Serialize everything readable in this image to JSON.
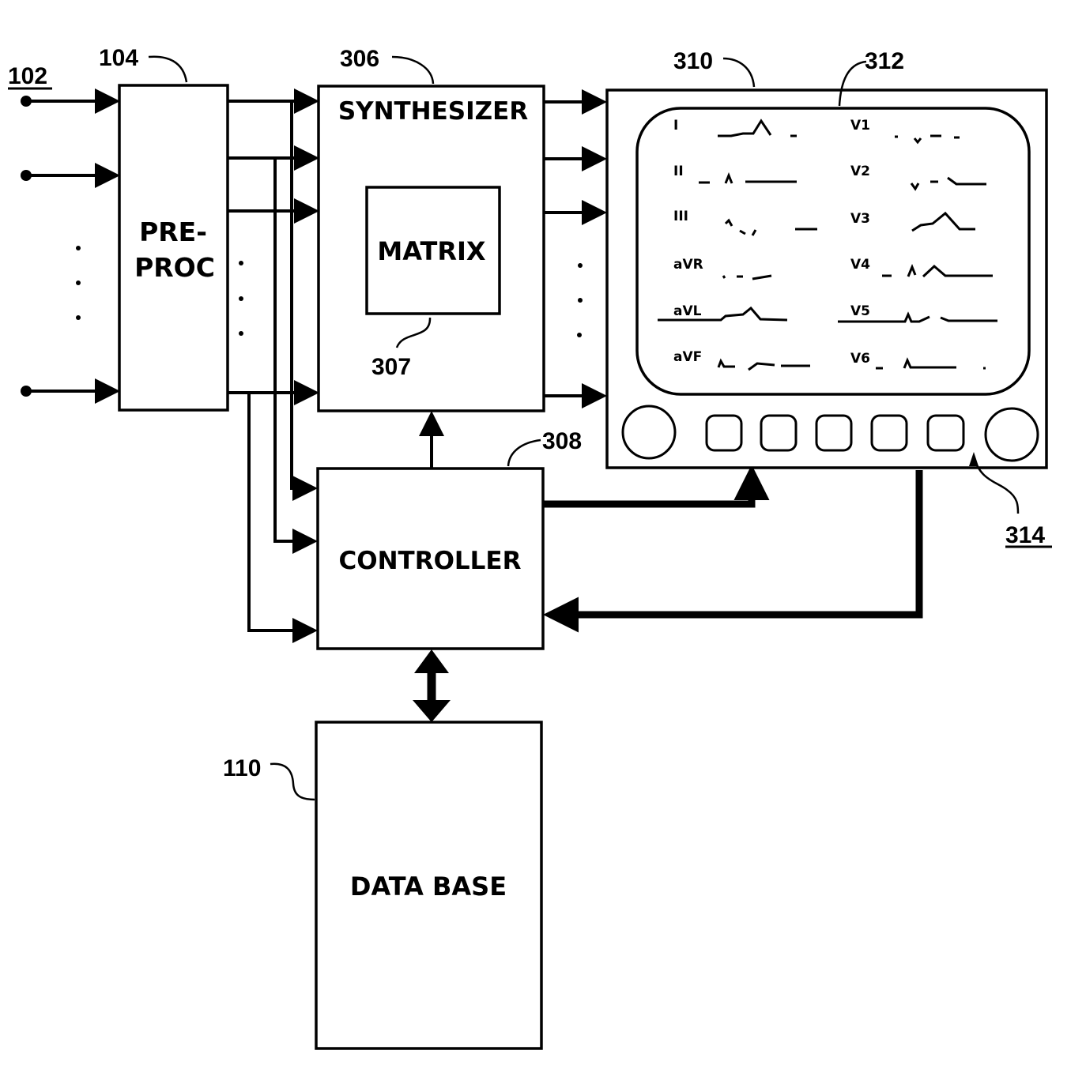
{
  "diagram": {
    "reference_numerals": {
      "inputs": "102",
      "preprocessor": "104",
      "synthesizer": "306",
      "matrix": "307",
      "controller": "308",
      "monitor": "310",
      "screen": "312",
      "controls": "314",
      "database": "110"
    },
    "blocks": {
      "preprocessor": {
        "line1": "PRE-",
        "line2": "PROC"
      },
      "synthesizer": {
        "title": "SYNTHESIZER"
      },
      "matrix": {
        "title": "MATRIX"
      },
      "controller": {
        "title": "CONTROLLER"
      },
      "database": {
        "title": "DATA BASE"
      }
    },
    "monitor": {
      "leads_left": [
        "I",
        "II",
        "III",
        "aVR",
        "aVL",
        "aVF"
      ],
      "leads_right": [
        "V1",
        "V2",
        "V3",
        "V4",
        "V5",
        "V6"
      ],
      "knobs": [
        "left-knob",
        "right-knob"
      ],
      "buttons_count": 5
    },
    "ellipsis": "⋮"
  }
}
